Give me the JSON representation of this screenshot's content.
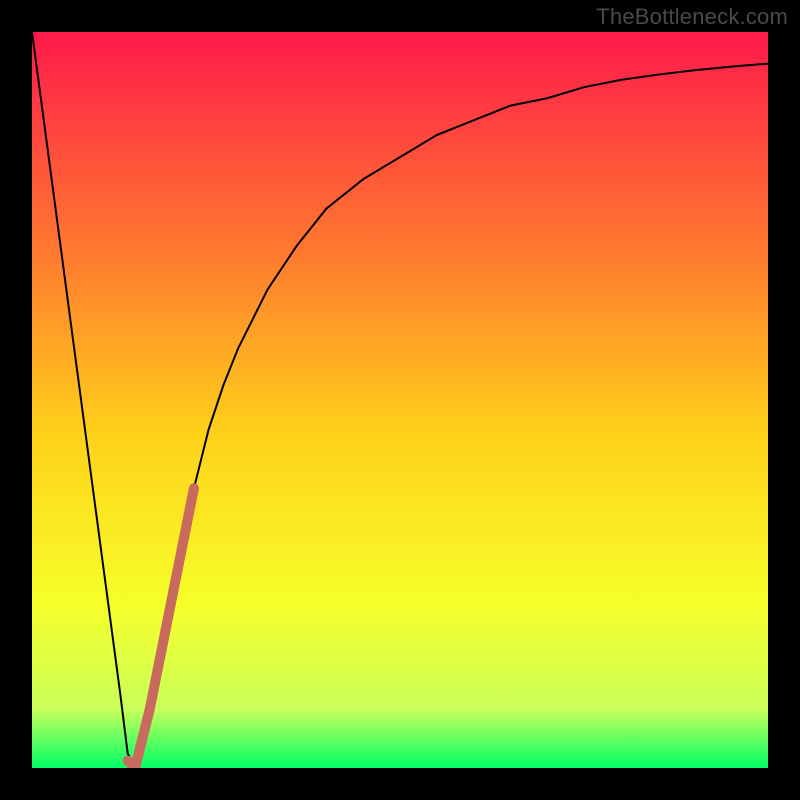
{
  "watermark": {
    "text": "TheBottleneck.com"
  },
  "chart_data": {
    "type": "line",
    "title": "",
    "xlabel": "",
    "ylabel": "",
    "xlim": [
      0,
      100
    ],
    "ylim": [
      0,
      100
    ],
    "grid": false,
    "legend": false,
    "background_gradient": {
      "stops": [
        {
          "offset": 0.0,
          "color": "#ff1a4b"
        },
        {
          "offset": 0.3,
          "color": "#ff7a2f"
        },
        {
          "offset": 0.55,
          "color": "#ffd21a"
        },
        {
          "offset": 0.78,
          "color": "#f6ff2a"
        },
        {
          "offset": 0.92,
          "color": "#c9ff5a"
        },
        {
          "offset": 1.0,
          "color": "#00ff66"
        }
      ]
    },
    "series": [
      {
        "name": "bottleneck-curve",
        "stroke": "#000000",
        "stroke_width": 2,
        "x": [
          0,
          2,
          4,
          6,
          8,
          10,
          12,
          13,
          14,
          16,
          18,
          20,
          22,
          24,
          26,
          28,
          32,
          36,
          40,
          45,
          50,
          55,
          60,
          65,
          70,
          75,
          80,
          85,
          90,
          95,
          100
        ],
        "y": [
          100,
          85,
          70,
          55,
          40,
          25,
          10,
          2,
          0,
          8,
          18,
          28,
          38,
          46,
          52,
          57,
          65,
          71,
          76,
          80,
          83,
          86,
          88,
          90,
          91,
          92.5,
          93.5,
          94.2,
          94.8,
          95.3,
          95.7
        ]
      },
      {
        "name": "highlight-segment",
        "stroke": "#c86a5d",
        "stroke_width": 10,
        "linecap": "round",
        "x": [
          13,
          14,
          16,
          18,
          20,
          22
        ],
        "y": [
          1,
          0,
          8,
          18,
          28,
          38
        ]
      }
    ]
  }
}
